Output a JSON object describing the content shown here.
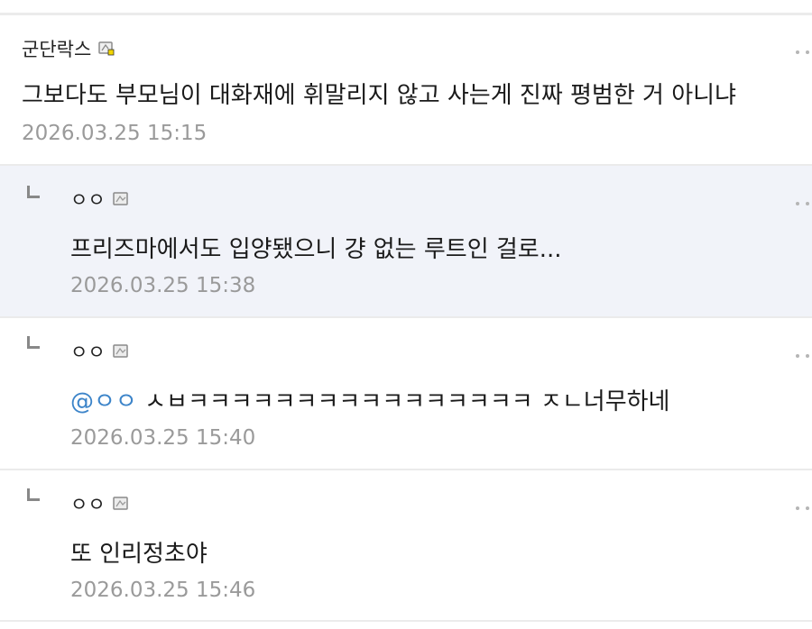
{
  "comments": [
    {
      "author": "군단락스",
      "body": "그보다도 부모님이 대화재에 휘말리지 않고 사는게 진짜 평범한 거 아니냐",
      "time": "2026.03.25 15:15",
      "is_reply": false,
      "icon": "gallery-badge-icon-gold"
    },
    {
      "author": "ㅇㅇ",
      "body": "프리즈마에서도 입양됐으니 걍 없는 루트인 걸로...",
      "time": "2026.03.25 15:38",
      "is_reply": true,
      "icon": "gallery-badge-icon-gray"
    },
    {
      "author": "ㅇㅇ",
      "mention": "@ㅇㅇ",
      "body": "ㅅㅂㅋㅋㅋㅋㅋㅋㅋㅋㅋㅋㅋㅋㅋㅋㅋㅋ ㅈㄴ너무하네",
      "time": "2026.03.25 15:40",
      "is_reply": true,
      "icon": "gallery-badge-icon-gray"
    },
    {
      "author": "ㅇㅇ",
      "body": "또 인리정초야",
      "time": "2026.03.25 15:46",
      "is_reply": true,
      "icon": "gallery-badge-icon-gray"
    }
  ],
  "colors": {
    "background": "#ebebeb",
    "card": "#ffffff",
    "highlight_card": "#f1f3f9",
    "mention": "#3c84c9",
    "timestamp": "#9a9a9a",
    "badge_gold": "#f2d400"
  }
}
